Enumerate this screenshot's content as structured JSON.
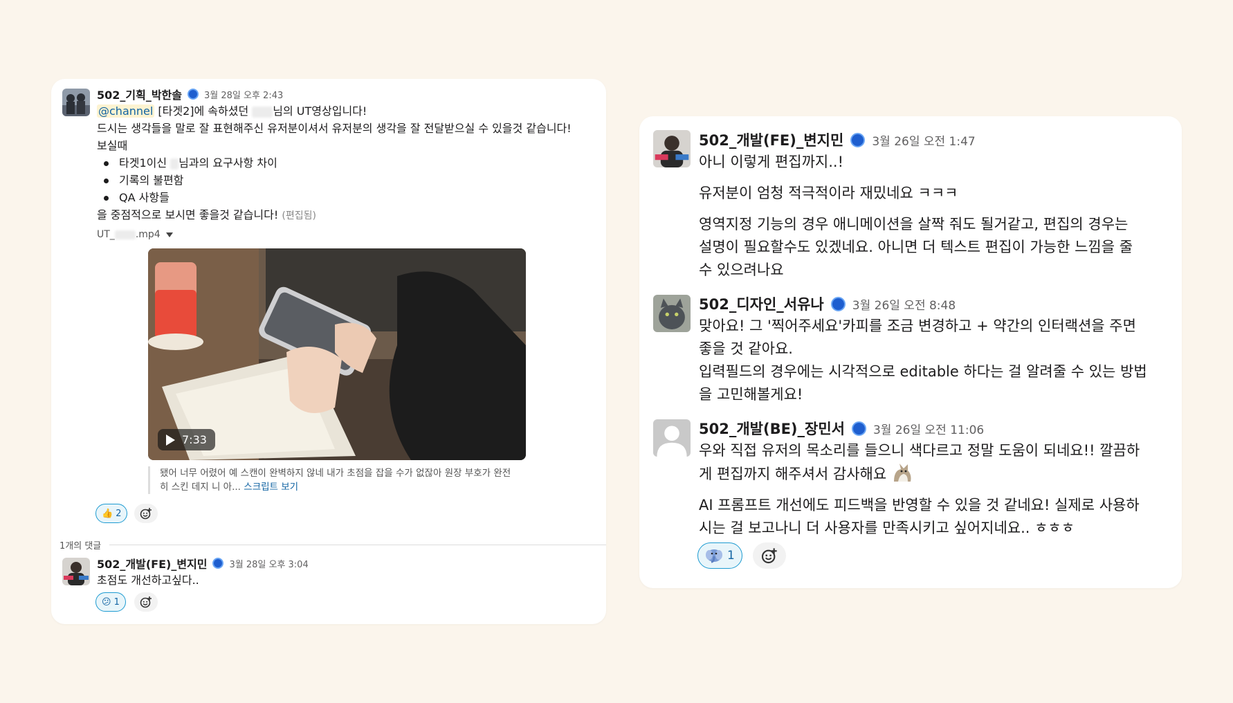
{
  "left_thread": {
    "parent": {
      "author": "502_기획_박한솔",
      "timestamp": "3월 28일 오후 2:43",
      "mention": "@channel",
      "line1_a": " [타겟2]에 속하셨던 ",
      "line1_b": "님의 UT영상입니다!",
      "line2": "드시는 생각들을 말로 잘 표현해주신 유저분이셔서 유저분의 생각을 잘 전달받으실 수 있을것 같습니다!",
      "line3": "보실때",
      "bullets": [
        {
          "a": "타겟1이신 ",
          "b": "님과의 요구사항 차이"
        },
        {
          "a": "기록의 불편함",
          "b": ""
        },
        {
          "a": "QA 사항들",
          "b": ""
        }
      ],
      "line4": "을 중점적으로 보시면 좋을것 같습니다!",
      "edited_tag": "(편집됨)",
      "file_prefix": "UT_",
      "file_suffix": ".mp4",
      "video_duration": "7:33",
      "transcript_line1": "됐어 너무 어렸어 예 스캔이 완벽하지 않네 내가 초점을 잡을 수가 없잖아 원장 부호가 완전",
      "transcript_line2": "히 스킨 데지 니 아... ",
      "transcript_link": "스크립트 보기",
      "reaction_emoji": "👍",
      "reaction_count": "2"
    },
    "reply_count_label": "1개의 댓글",
    "reply": {
      "author": "502_개발(FE)_변지민",
      "timestamp": "3월 28일 오후 3:04",
      "text": "초점도 개선하고싶다..",
      "reaction_emoji": "😕",
      "reaction_count": "1"
    }
  },
  "right_thread": {
    "messages": [
      {
        "author": "502_개발(FE)_변지민",
        "timestamp": "3월 26일 오전 1:47",
        "lines": [
          "아니 이렇게 편집까지..!",
          "유저분이 엄청 적극적이라 재밌네요 ㅋㅋㅋ",
          "영역지정 기능의 경우 애니메이션을 살짝 줘도 될거같고,  편집의 경우는",
          "설명이 필요할수도 있겠네요. 아니면 더 텍스트 편집이 가능한 느낌을 줄",
          "수 있으려나요"
        ]
      },
      {
        "author": "502_디자인_서유나",
        "timestamp": "3월 26일 오전 8:48",
        "lines": [
          "맞아요! 그 '찍어주세요'카피를 조금 변경하고 + 약간의 인터랙션을 주면",
          "좋을 것 같아요.",
          "입력필드의 경우에는 시각적으로 editable 하다는 걸 알려줄 수 있는 방법",
          "을 고민해볼게요!"
        ]
      },
      {
        "author": "502_개발(BE)_장민서",
        "timestamp": "3월 26일 오전 11:06",
        "lines": [
          "우와 직접 유저의 목소리를 들으니 색다르고 정말 도움이 되네요!! 깔끔하",
          "게 편집까지 해주셔서 감사해요",
          "AI 프롬프트 개선에도 피드백을 반영할 수 있을 것 같네요! 실제로 사용하",
          "시는 걸 보고나니 더 사용자를 만족시키고 싶어지네요.. ㅎㅎㅎ"
        ],
        "reaction_count": "1"
      }
    ]
  },
  "icons": {
    "verified_badge": "blue-dot-icon",
    "add_reaction": "add-emoji-icon",
    "play": "play-icon",
    "dropdown": "caret-down-icon"
  },
  "colors": {
    "background": "#fbf5ec",
    "link": "#1264a3",
    "badge": "#1e5ecf",
    "mention_bg": "#fdf3d1",
    "reaction_border": "#1d9bd1"
  }
}
